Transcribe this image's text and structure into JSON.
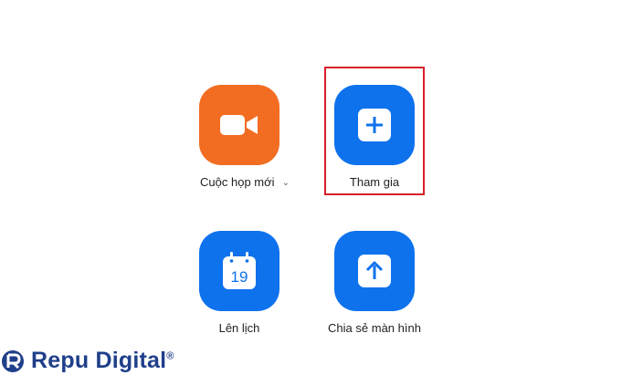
{
  "actions": {
    "new_meeting": {
      "label": "Cuộc họp mới",
      "icon": "video-camera-icon",
      "color": "#f26d21"
    },
    "join": {
      "label": "Tham gia",
      "icon": "plus-icon",
      "color": "#0e72ed"
    },
    "schedule": {
      "label": "Lên lịch",
      "icon": "calendar-icon",
      "calendar_day": "19",
      "color": "#0e72ed"
    },
    "share_screen": {
      "label": "Chia sẻ màn hình",
      "icon": "upload-arrow-icon",
      "color": "#0e72ed"
    }
  },
  "highlight_color": "#d81e2a",
  "watermark": {
    "text": "Repu Digital",
    "mark": "®",
    "color": "#1f3f8a"
  }
}
